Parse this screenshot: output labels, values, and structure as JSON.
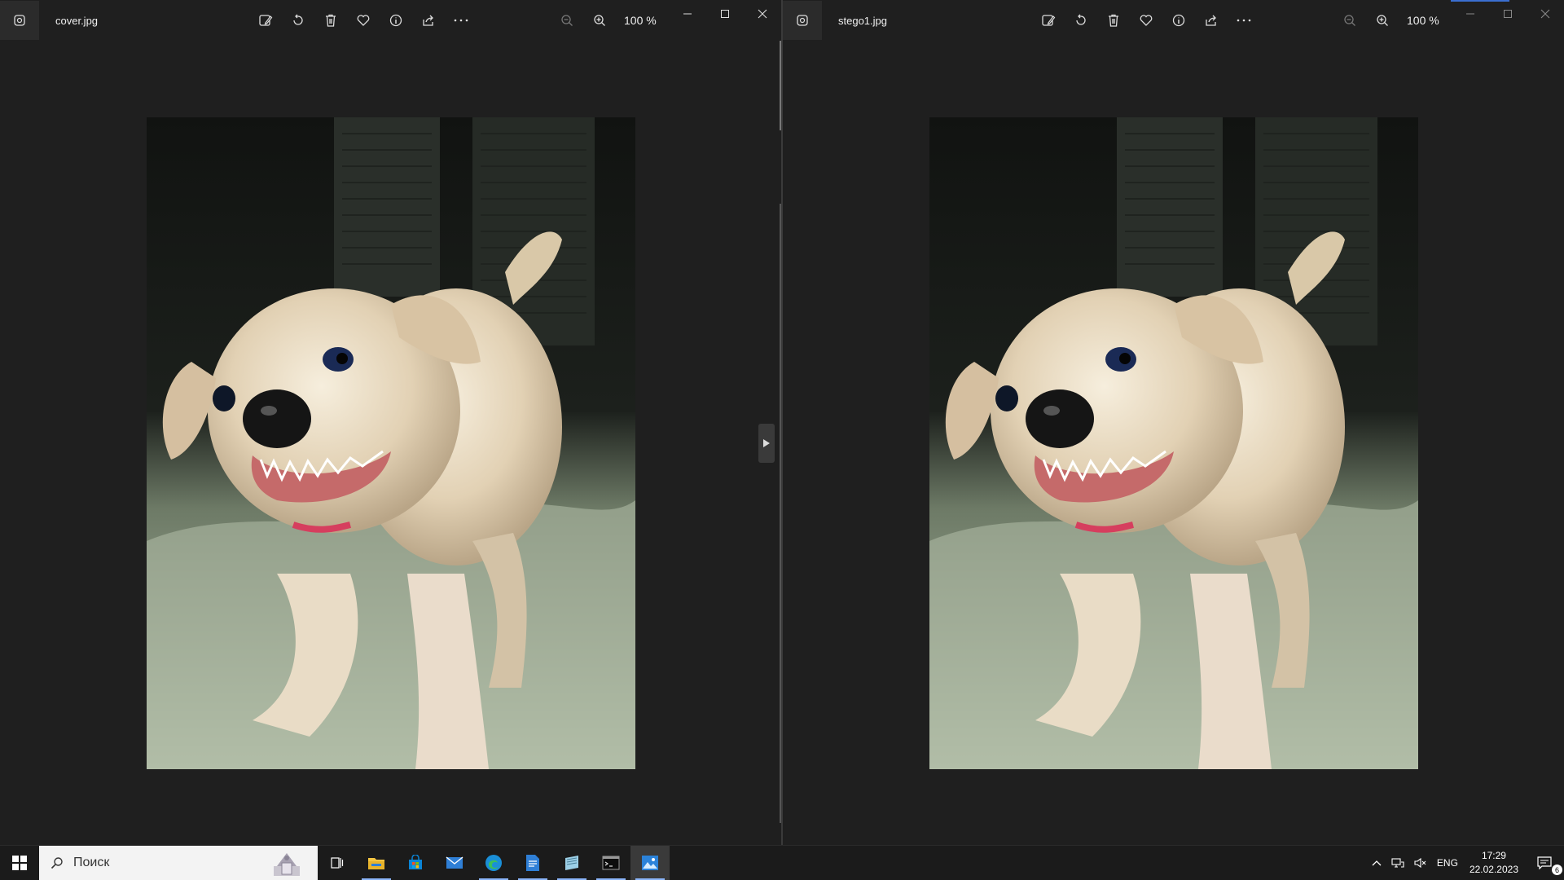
{
  "viewers": [
    {
      "filename": "cover.jpg",
      "zoom": "100 %"
    },
    {
      "filename": "stego1.jpg",
      "zoom": "100 %"
    }
  ],
  "taskbar": {
    "search_placeholder": "Поиск",
    "language": "ENG",
    "time": "17:29",
    "date": "22.02.2023",
    "notification_count": "6"
  }
}
